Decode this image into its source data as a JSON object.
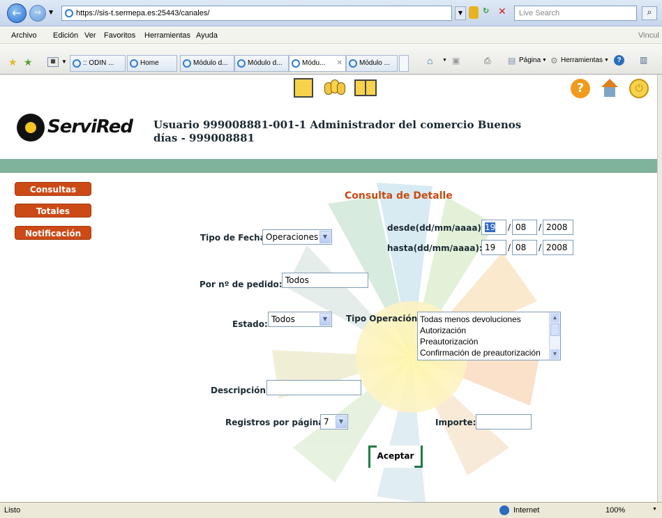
{
  "browser": {
    "address": "https://sis-t.sermepa.es:25443/canales/",
    "search_placeholder": "Live Search",
    "menu": [
      "Archivo",
      "Edición",
      "Ver",
      "Favoritos",
      "Herramientas",
      "Ayuda"
    ],
    "menu_right": "Vincul",
    "tabs": [
      ":: ODIN ...",
      "Home",
      "Módulo d...",
      "Módulo d...",
      "Módu...",
      "Módulo ..."
    ],
    "toolbar": {
      "page": "Página",
      "tools": "Herramientas"
    },
    "status_left": "Listo",
    "status_zone": "Internet",
    "zoom": "100%"
  },
  "app": {
    "logo_text": "ServiRed",
    "user_line1": "Usuario 999008881-001-1   Administrador del comercio   Buenos",
    "user_line2": "días - 999008881"
  },
  "sidebar": [
    "Consultas",
    "Totales",
    "Notificación"
  ],
  "form": {
    "title": "Consulta de Detalle",
    "tipo_fecha_label": "Tipo de Fecha:",
    "tipo_fecha_value": "Operaciones",
    "desde_label": "desde(dd/mm/aaaa):",
    "desde": {
      "dd": "19",
      "mm": "08",
      "aaaa": "2008"
    },
    "hasta_label": "hasta(dd/mm/aaaa):",
    "hasta": {
      "dd": "19",
      "mm": "08",
      "aaaa": "2008"
    },
    "pedido_label": "Por nº de pedido:",
    "pedido_value": "Todos",
    "estado_label": "Estado:",
    "estado_value": "Todos",
    "tipo_op_label": "Tipo Operación:",
    "tipo_op_options": [
      "Todas menos devoluciones",
      "Autorización",
      "Preautorización",
      "Confirmación de preautorización"
    ],
    "descripcion_label": "Descripción:",
    "registros_label": "Registros por página:",
    "registros_value": "7",
    "importe_label": "Importe:",
    "aceptar": "Aceptar",
    "slash": "/"
  },
  "colors": {
    "accent": "#cc4a16",
    "band": "#7fb39c",
    "title": "#c94a12"
  }
}
